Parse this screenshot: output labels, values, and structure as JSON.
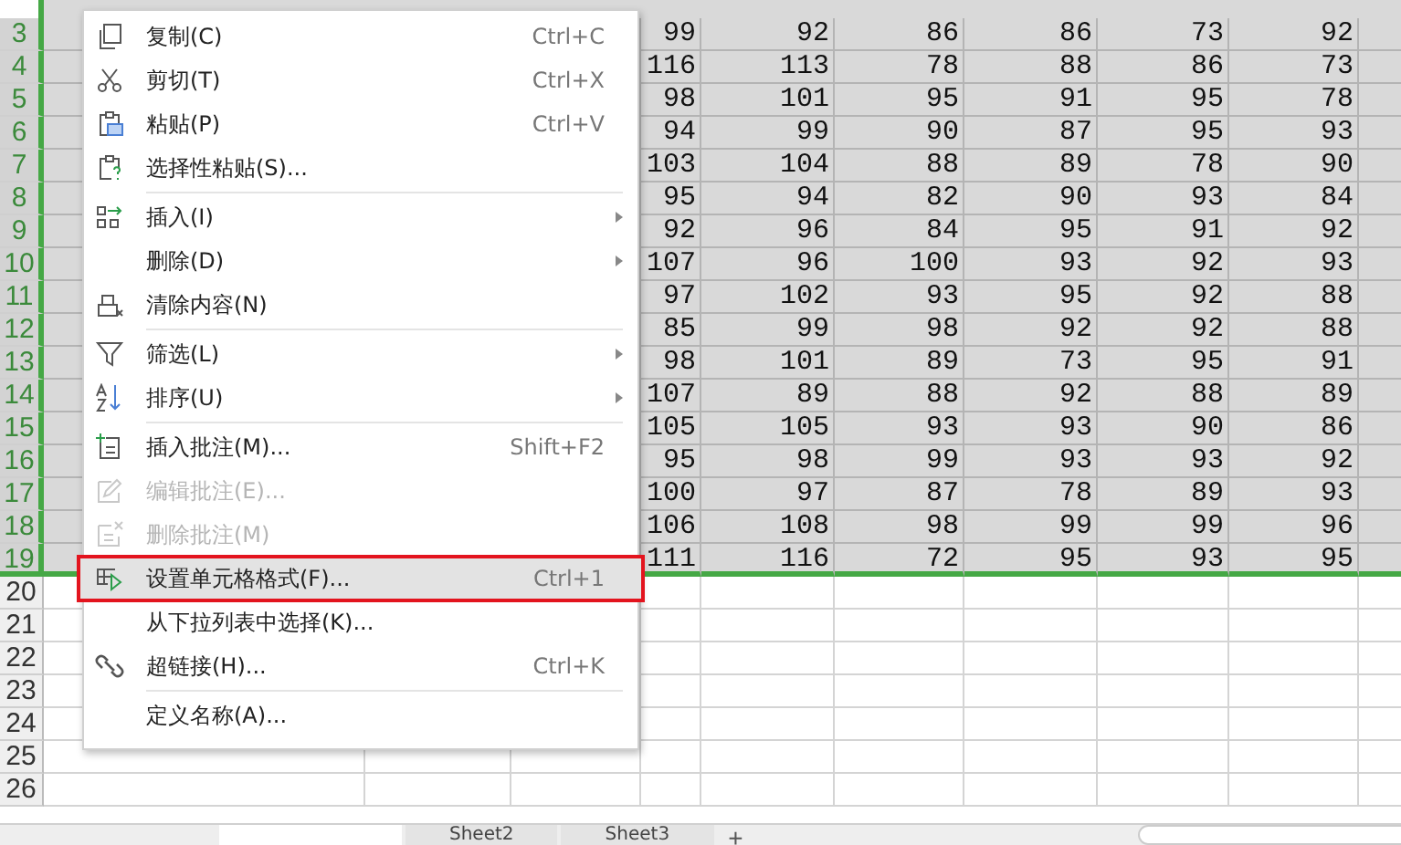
{
  "sheet": {
    "rows": [
      {
        "number": "3",
        "selected": true,
        "cells": [
          "99",
          "92",
          "86",
          "86",
          "73",
          "92"
        ]
      },
      {
        "number": "4",
        "selected": true,
        "cells": [
          "116",
          "113",
          "78",
          "88",
          "86",
          "73"
        ]
      },
      {
        "number": "5",
        "selected": true,
        "cells": [
          "98",
          "101",
          "95",
          "91",
          "95",
          "78"
        ]
      },
      {
        "number": "6",
        "selected": true,
        "cells": [
          "94",
          "99",
          "90",
          "87",
          "95",
          "93"
        ]
      },
      {
        "number": "7",
        "selected": true,
        "cells": [
          "103",
          "104",
          "88",
          "89",
          "78",
          "90"
        ]
      },
      {
        "number": "8",
        "selected": true,
        "cells": [
          "95",
          "94",
          "82",
          "90",
          "93",
          "84"
        ]
      },
      {
        "number": "9",
        "selected": true,
        "cells": [
          "92",
          "96",
          "84",
          "95",
          "91",
          "92"
        ]
      },
      {
        "number": "10",
        "selected": true,
        "cells": [
          "107",
          "96",
          "100",
          "93",
          "92",
          "93"
        ]
      },
      {
        "number": "11",
        "selected": true,
        "cells": [
          "97",
          "102",
          "93",
          "95",
          "92",
          "88"
        ]
      },
      {
        "number": "12",
        "selected": true,
        "cells": [
          "85",
          "99",
          "98",
          "92",
          "92",
          "88"
        ]
      },
      {
        "number": "13",
        "selected": true,
        "cells": [
          "98",
          "101",
          "89",
          "73",
          "95",
          "91"
        ]
      },
      {
        "number": "14",
        "selected": true,
        "cells": [
          "107",
          "89",
          "88",
          "92",
          "88",
          "89"
        ]
      },
      {
        "number": "15",
        "selected": true,
        "cells": [
          "105",
          "105",
          "93",
          "93",
          "90",
          "86"
        ]
      },
      {
        "number": "16",
        "selected": true,
        "cells": [
          "95",
          "98",
          "99",
          "93",
          "93",
          "92"
        ]
      },
      {
        "number": "17",
        "selected": true,
        "cells": [
          "100",
          "97",
          "87",
          "78",
          "89",
          "93"
        ]
      },
      {
        "number": "18",
        "selected": true,
        "cells": [
          "106",
          "108",
          "98",
          "99",
          "99",
          "96"
        ]
      },
      {
        "number": "19",
        "selected": true,
        "cells": [
          "111",
          "116",
          "72",
          "95",
          "93",
          "95"
        ]
      },
      {
        "number": "20",
        "selected": false,
        "cells": []
      },
      {
        "number": "21",
        "selected": false,
        "cells": []
      },
      {
        "number": "22",
        "selected": false,
        "cells": []
      },
      {
        "number": "23",
        "selected": false,
        "cells": []
      },
      {
        "number": "24",
        "selected": false,
        "cells": []
      },
      {
        "number": "25",
        "selected": false,
        "cells": []
      },
      {
        "number": "26",
        "selected": false,
        "cells": []
      }
    ]
  },
  "context_menu": {
    "items": [
      {
        "kind": "item",
        "label": "复制(C)",
        "shortcut": "Ctrl+C",
        "disabled": false,
        "selected": false,
        "submenu": false,
        "annotated": false
      },
      {
        "kind": "item",
        "label": "剪切(T)",
        "shortcut": "Ctrl+X",
        "disabled": false,
        "selected": false,
        "submenu": false,
        "annotated": false
      },
      {
        "kind": "item",
        "label": "粘贴(P)",
        "shortcut": "Ctrl+V",
        "disabled": false,
        "selected": false,
        "submenu": false,
        "annotated": false
      },
      {
        "kind": "item",
        "label": "选择性粘贴(S)...",
        "disabled": false,
        "selected": false,
        "submenu": false,
        "annotated": false
      },
      {
        "kind": "separator"
      },
      {
        "kind": "item",
        "label": "插入(I)",
        "disabled": false,
        "selected": false,
        "submenu": true,
        "annotated": false
      },
      {
        "kind": "item",
        "label": "删除(D)",
        "disabled": false,
        "selected": false,
        "submenu": true,
        "annotated": false
      },
      {
        "kind": "item",
        "label": "清除内容(N)",
        "disabled": false,
        "selected": false,
        "submenu": false,
        "annotated": false
      },
      {
        "kind": "separator"
      },
      {
        "kind": "item",
        "label": "筛选(L)",
        "disabled": false,
        "selected": false,
        "submenu": true,
        "annotated": false
      },
      {
        "kind": "item",
        "label": "排序(U)",
        "disabled": false,
        "selected": false,
        "submenu": true,
        "annotated": false
      },
      {
        "kind": "separator"
      },
      {
        "kind": "item",
        "label": "插入批注(M)...",
        "shortcut": "Shift+F2",
        "disabled": false,
        "selected": false,
        "submenu": false,
        "annotated": false
      },
      {
        "kind": "item",
        "label": "编辑批注(E)...",
        "disabled": true,
        "selected": false,
        "submenu": false,
        "annotated": false
      },
      {
        "kind": "item",
        "label": "删除批注(M)",
        "disabled": true,
        "selected": false,
        "submenu": false,
        "annotated": false
      },
      {
        "kind": "item",
        "label": "设置单元格格式(F)...",
        "shortcut": "Ctrl+1",
        "disabled": false,
        "selected": true,
        "submenu": false,
        "annotated": true
      },
      {
        "kind": "item",
        "label": "从下拉列表中选择(K)...",
        "disabled": false,
        "selected": false,
        "submenu": false,
        "annotated": false
      },
      {
        "kind": "item",
        "label": "超链接(H)...",
        "shortcut": "Ctrl+K",
        "disabled": false,
        "selected": false,
        "submenu": false,
        "annotated": false
      },
      {
        "kind": "separator"
      },
      {
        "kind": "item",
        "label": "定义名称(A)...",
        "disabled": false,
        "selected": false,
        "submenu": false,
        "annotated": false
      }
    ]
  },
  "sheet_tabs": {
    "tabs": [
      {
        "selected": true
      },
      {
        "label": "Sheet2",
        "selected": false
      },
      {
        "label": "Sheet3",
        "selected": false
      }
    ],
    "add_button": "+"
  }
}
